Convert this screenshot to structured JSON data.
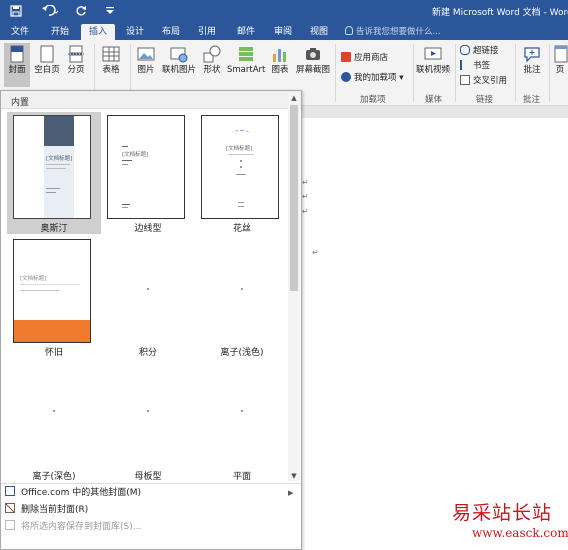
{
  "titlebar": {
    "title": "新建 Microsoft Word 文档 - Word",
    "save_icon": "save-icon",
    "undo_icon": "undo-icon",
    "redo_icon": "repeat-icon",
    "customize_icon": "customize-qat-icon"
  },
  "tabs": [
    "文件",
    "开始",
    "插入",
    "设计",
    "布局",
    "引用",
    "邮件",
    "审阅",
    "视图"
  ],
  "active_tab": "插入",
  "tell_me": "告诉我您想要做什么...",
  "ribbon": {
    "cover": "封面",
    "blank_page": "空白页",
    "page_break": "分页",
    "table": "表格",
    "picture": "图片",
    "online_picture": "联机图片",
    "shapes": "形状",
    "smartart": "SmartArt",
    "chart": "图表",
    "screenshot": "屏幕截图",
    "store": "应用商店",
    "my_addins": "我的加载项",
    "addins_group": "加载项",
    "online_video": "联机视频",
    "media_group": "媒体",
    "hyperlink": "超链接",
    "bookmark": "书签",
    "cross_ref": "交叉引用",
    "links_group": "链接",
    "comment": "批注",
    "comments_group": "批注",
    "more": "页"
  },
  "gallery": {
    "header": "内置",
    "covers": [
      {
        "name": "奥斯汀",
        "selected": true,
        "placeholder": "[文档标题]"
      },
      {
        "name": "边线型",
        "selected": false,
        "placeholder": "[文档标题]"
      },
      {
        "name": "花丝",
        "selected": false,
        "placeholder": "[文档标题]"
      },
      {
        "name": "怀旧",
        "selected": false,
        "placeholder": "[文档标题]"
      },
      {
        "name": "积分",
        "selected": false,
        "placeholder": ""
      },
      {
        "name": "离子(浅色)",
        "selected": false,
        "placeholder": ""
      },
      {
        "name": "离子(深色)",
        "selected": false,
        "placeholder": ""
      },
      {
        "name": "母板型",
        "selected": false,
        "placeholder": ""
      },
      {
        "name": "平面",
        "selected": false,
        "placeholder": ""
      }
    ],
    "menu": {
      "more_covers": "Office.com 中的其他封面(M)",
      "remove_cover": "删除当前封面(R)",
      "save_selection": "将所选内容保存到封面库(S)..."
    }
  },
  "colors": {
    "title_bar": "#2b579a",
    "austin_accent": "#4a5d75",
    "retro_accent": "#f07b2c",
    "watermark": "#c5161d"
  },
  "watermark": {
    "text": "易采站长站",
    "url": "www.easck.com"
  }
}
